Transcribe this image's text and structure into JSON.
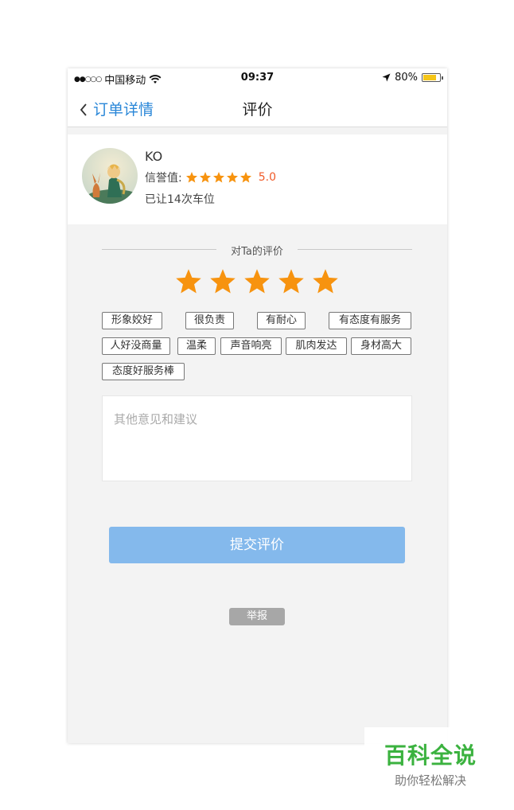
{
  "status_bar": {
    "signal": "●●○○○",
    "carrier": "中国移动",
    "time": "09:37",
    "battery": "80%",
    "battery_level": 0.8,
    "battery_color": "#f5c518"
  },
  "nav": {
    "back_label": "订单详情",
    "title": "评价"
  },
  "profile": {
    "name": "KO",
    "reputation_label": "信誉值:",
    "reputation_stars": 5,
    "reputation_score": "5.0",
    "yield_count_text": "已让14次车位"
  },
  "rating": {
    "section_label": "对Ta的评价",
    "stars": 5,
    "star_color": "#f7930f"
  },
  "tags": [
    "形象姣好",
    "很负责",
    "有耐心",
    "有态度有服务",
    "人好没商量",
    "温柔",
    "声音响亮",
    "肌肉发达",
    "身材高大",
    "态度好服务棒"
  ],
  "comment": {
    "placeholder": "其他意见和建议"
  },
  "submit_label": "提交评价",
  "report_label": "举报",
  "watermark": {
    "main": "百科全说",
    "sub": "助你轻松解决"
  },
  "colors": {
    "accent": "#2a87d8",
    "submit_bg": "#84b9ec",
    "score": "#f05a28"
  }
}
